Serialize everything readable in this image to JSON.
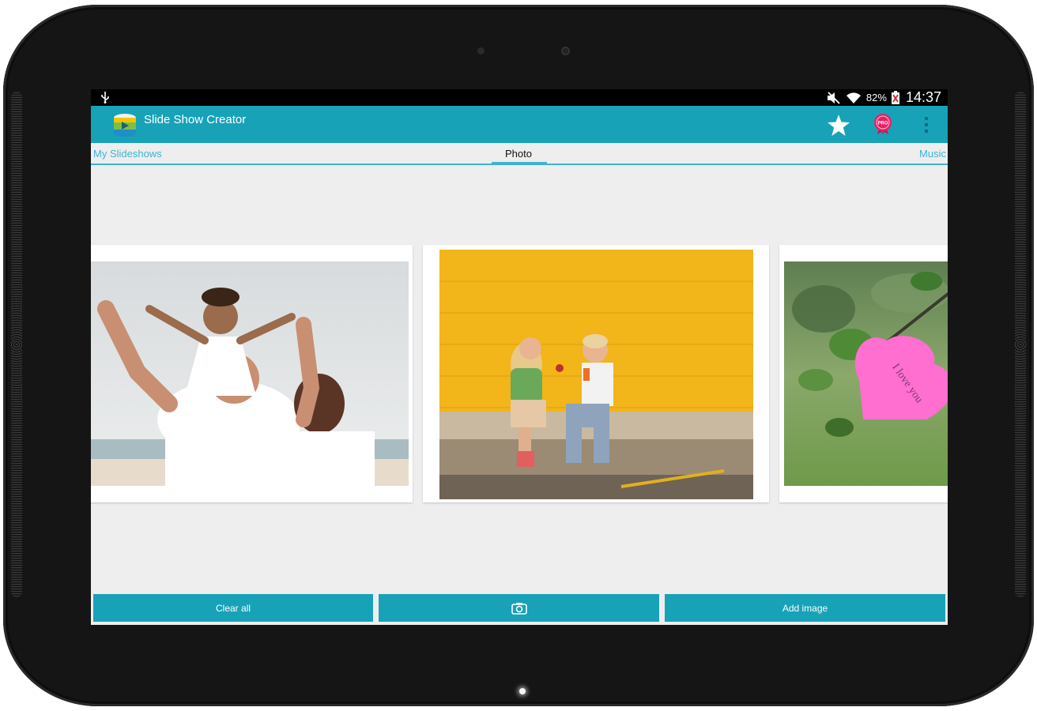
{
  "status_bar": {
    "battery_percent": "82%",
    "time": "14:37",
    "icons": [
      "usb-icon",
      "mute-icon",
      "wifi-icon",
      "battery-icon"
    ]
  },
  "action_bar": {
    "title": "Slide Show Creator",
    "icons": [
      "app-logo-icon",
      "star-icon",
      "pro-badge-icon",
      "overflow-menu-icon"
    ],
    "pro_badge_text": "PRO"
  },
  "tabs": [
    {
      "label": "My Slideshows",
      "selected": false
    },
    {
      "label": "Photo",
      "selected": true
    },
    {
      "label": "Music",
      "selected": false
    }
  ],
  "photos": [
    {
      "description_icon": "family-beach-photo"
    },
    {
      "description_icon": "kids-yellow-wall-photo"
    },
    {
      "description_icon": "heart-note-photo",
      "note_text": "I love you"
    }
  ],
  "buttons": {
    "clear_all": "Clear all",
    "camera_icon": "camera-icon",
    "add_image": "Add image"
  },
  "colors": {
    "accent": "#17a2b8",
    "tab_accent": "#3fb3d6",
    "background": "#eeeeee"
  }
}
